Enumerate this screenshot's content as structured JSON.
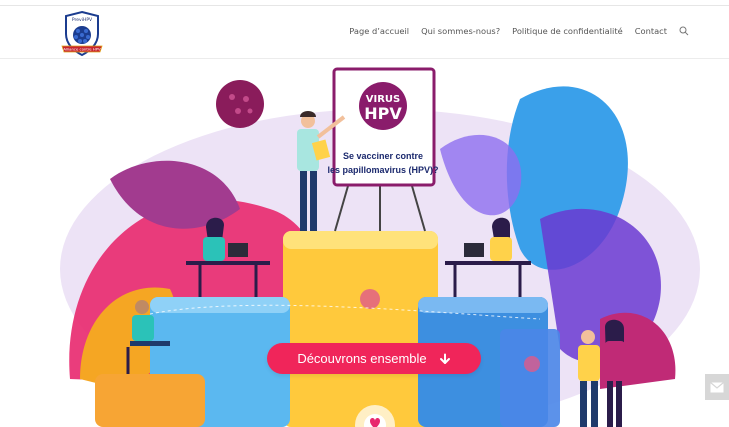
{
  "header": {
    "logo": {
      "top_text": "PreviHPV",
      "ribbon_text": "Alliance contre HPV",
      "colors": {
        "shield_blue": "#1b3c8f",
        "ribbon_red": "#c7242f",
        "frame_gold": "#e0a21a"
      }
    },
    "nav": [
      {
        "label": "Page d’accueil"
      },
      {
        "label": "Qui sommes-nous?"
      },
      {
        "label": "Politique de confidentialité"
      },
      {
        "label": "Contact"
      }
    ],
    "search_icon": "search-icon"
  },
  "hero": {
    "board": {
      "line1": "VIRUS",
      "line2": "HPV",
      "line3": "Se vacciner contre",
      "line4": "les papillomavirus (HPV)?"
    },
    "cta_label": "Découvrons ensemble",
    "cta_icon": "arrow-down-icon",
    "colors": {
      "cta": "#f0255a",
      "board_purple": "#8a1c6b",
      "bg_lavender": "#e9e1f4",
      "pink": "#e8286e",
      "blue": "#3aa0ea",
      "yellow": "#ffd24a"
    }
  },
  "floating": {
    "mail_icon": "mail-icon"
  }
}
